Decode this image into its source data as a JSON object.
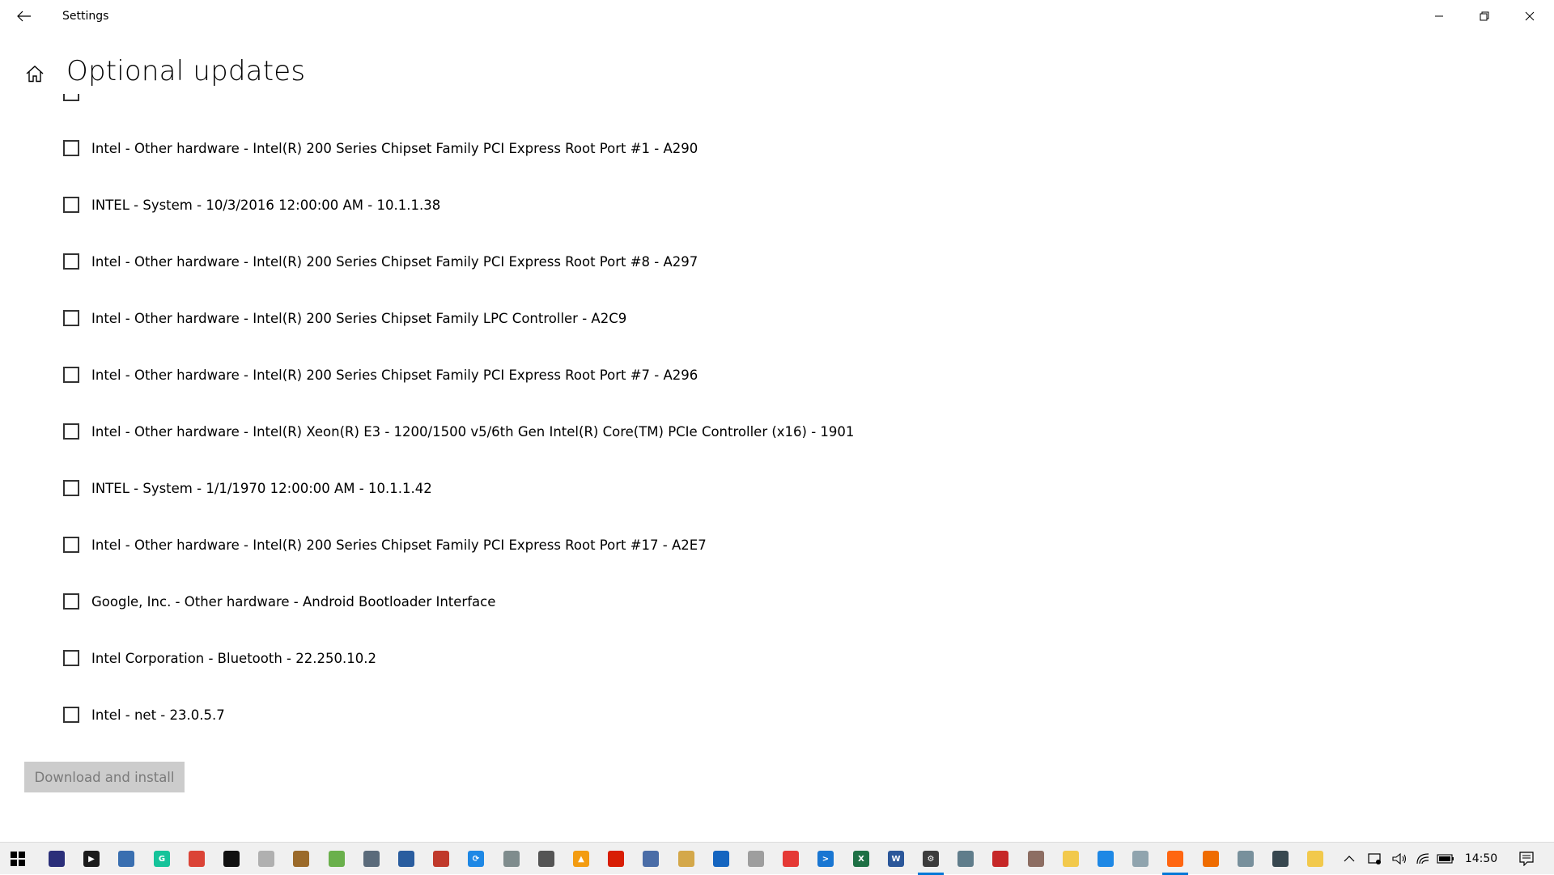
{
  "window": {
    "title": "Settings",
    "icons": {
      "back": "back-arrow-icon",
      "minimize": "minimize-icon",
      "restore": "restore-icon",
      "close": "close-icon"
    }
  },
  "header": {
    "title": "Optional updates",
    "home_icon": "home-icon"
  },
  "updates": [
    {
      "label": "Intel - Other hardware - Intel(R) 200 Series Chipset Family PCI Express Root Port #1 - A290",
      "checked": false
    },
    {
      "label": "INTEL - System - 10/3/2016 12:00:00 AM - 10.1.1.38",
      "checked": false
    },
    {
      "label": "Intel - Other hardware - Intel(R) 200 Series Chipset Family PCI Express Root Port #8 - A297",
      "checked": false
    },
    {
      "label": "Intel - Other hardware - Intel(R) 200 Series Chipset Family LPC Controller - A2C9",
      "checked": false
    },
    {
      "label": "Intel - Other hardware - Intel(R) 200 Series Chipset Family PCI Express Root Port #7 - A296",
      "checked": false
    },
    {
      "label": "Intel - Other hardware - Intel(R) Xeon(R) E3 - 1200/1500 v5/6th Gen Intel(R) Core(TM) PCIe Controller (x16) - 1901",
      "checked": false
    },
    {
      "label": "INTEL - System - 1/1/1970 12:00:00 AM - 10.1.1.42",
      "checked": false
    },
    {
      "label": "Intel - Other hardware - Intel(R) 200 Series Chipset Family PCI Express Root Port #17 - A2E7",
      "checked": false
    },
    {
      "label": "Google, Inc. - Other hardware - Android Bootloader Interface",
      "checked": false
    },
    {
      "label": "Intel Corporation - Bluetooth - 22.250.10.2",
      "checked": false
    },
    {
      "label": "Intel - net - 23.0.5.7",
      "checked": false
    }
  ],
  "download_button": {
    "label": "Download and install",
    "disabled": true
  },
  "taskbar": {
    "start_icon": "windows-start-icon",
    "apps": [
      {
        "icon": "calculator-keypad-icon",
        "color": "#2b2f7a",
        "glyph": ""
      },
      {
        "icon": "media-player-icon",
        "color": "#1b1b1b",
        "glyph": "▶"
      },
      {
        "icon": "monitor-app-icon",
        "color": "#3a6fb0",
        "glyph": ""
      },
      {
        "icon": "grammarly-icon",
        "color": "#15c39a",
        "glyph": "G"
      },
      {
        "icon": "chrome-icon",
        "color": "#db4437",
        "glyph": ""
      },
      {
        "icon": "terminal-icon",
        "color": "#111111",
        "glyph": ""
      },
      {
        "icon": "puzzle-app-icon",
        "color": "#b0b0b0",
        "glyph": ""
      },
      {
        "icon": "game-app-icon",
        "color": "#9b6a2a",
        "glyph": ""
      },
      {
        "icon": "green-app-icon",
        "color": "#6ab04c",
        "glyph": ""
      },
      {
        "icon": "calculator-icon",
        "color": "#5b6b7b",
        "glyph": ""
      },
      {
        "icon": "clock-app-icon",
        "color": "#2a5d9f",
        "glyph": ""
      },
      {
        "icon": "archive-app-icon",
        "color": "#c0392b",
        "glyph": ""
      },
      {
        "icon": "sync-icon",
        "color": "#1e88e5",
        "glyph": "⟳"
      },
      {
        "icon": "chart-app-icon",
        "color": "#7f8c8d",
        "glyph": ""
      },
      {
        "icon": "gear-app-icon",
        "color": "#555555",
        "glyph": ""
      },
      {
        "icon": "vlc-icon",
        "color": "#f39c12",
        "glyph": "▲"
      },
      {
        "icon": "pdf-reader-icon",
        "color": "#d81e05",
        "glyph": ""
      },
      {
        "icon": "window-app-icon",
        "color": "#4a6da7",
        "glyph": ""
      },
      {
        "icon": "alpari-icon",
        "color": "#d4a84a",
        "glyph": ""
      },
      {
        "icon": "blue-app-icon",
        "color": "#1565c0",
        "glyph": ""
      },
      {
        "icon": "paint-app-icon",
        "color": "#9e9e9e",
        "glyph": ""
      },
      {
        "icon": "red-app-icon",
        "color": "#e53935",
        "glyph": ""
      },
      {
        "icon": "powershell-icon",
        "color": "#1976d2",
        "glyph": ">"
      },
      {
        "icon": "excel-icon",
        "color": "#1e7145",
        "glyph": "X"
      },
      {
        "icon": "word-icon",
        "color": "#2b579a",
        "glyph": "W"
      },
      {
        "icon": "settings-icon",
        "color": "#3c3c3c",
        "glyph": "⚙",
        "active": true
      },
      {
        "icon": "laptop-app-icon",
        "color": "#607d8b",
        "glyph": ""
      },
      {
        "icon": "search-app-icon",
        "color": "#c62828",
        "glyph": ""
      },
      {
        "icon": "briefcase-icon",
        "color": "#8d6e63",
        "glyph": ""
      },
      {
        "icon": "file-explorer-icon",
        "color": "#f2c94c",
        "glyph": ""
      },
      {
        "icon": "remote-desktop-icon",
        "color": "#1e88e5",
        "glyph": ""
      },
      {
        "icon": "glass-app-icon",
        "color": "#90a4ae",
        "glyph": ""
      },
      {
        "icon": "firefox-icon",
        "color": "#ff6611",
        "glyph": "",
        "active": true
      },
      {
        "icon": "video-app-icon",
        "color": "#ef6c00",
        "glyph": ""
      },
      {
        "icon": "camera-app-icon",
        "color": "#78909c",
        "glyph": ""
      },
      {
        "icon": "photo-app-icon",
        "color": "#37474f",
        "glyph": ""
      },
      {
        "icon": "folder-app-icon",
        "color": "#f2c94c",
        "glyph": ""
      }
    ],
    "tray": {
      "icons": [
        "chevron-up-icon",
        "device-icon",
        "volume-icon",
        "wifi-icon",
        "battery-icon"
      ],
      "time": "14:50",
      "notification_icon": "notification-icon"
    }
  }
}
